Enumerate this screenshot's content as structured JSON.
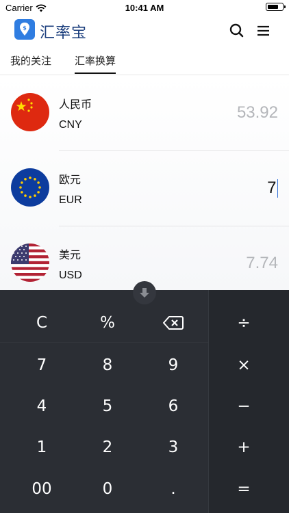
{
  "status_bar": {
    "carrier": "Carrier",
    "time": "10:41 AM"
  },
  "header": {
    "app_title": "汇率宝",
    "search_icon": "search-icon",
    "menu_icon": "menu-icon"
  },
  "tabs": [
    {
      "label": "我的关注",
      "active": false
    },
    {
      "label": "汇率换算",
      "active": true
    }
  ],
  "currencies": [
    {
      "name": "人民币",
      "code": "CNY",
      "amount": "53.92",
      "flag": "china-flag",
      "active": false
    },
    {
      "name": "欧元",
      "code": "EUR",
      "amount": "7",
      "flag": "eu-flag",
      "active": true
    },
    {
      "name": "美元",
      "code": "USD",
      "amount": "7.74",
      "flag": "us-flag",
      "active": false
    }
  ],
  "keypad": {
    "rows": [
      [
        "C",
        "%",
        "⌫"
      ],
      [
        "7",
        "8",
        "9"
      ],
      [
        "4",
        "5",
        "6"
      ],
      [
        "1",
        "2",
        "3"
      ],
      [
        "00",
        "0",
        "."
      ]
    ],
    "operators": [
      "÷",
      "×",
      "−",
      "+",
      "="
    ]
  },
  "colors": {
    "accent": "#2b6bd6",
    "keyboard_bg": "#2b2e34",
    "inactive_amount": "#b4b6ba",
    "title": "#1a3d7c"
  }
}
